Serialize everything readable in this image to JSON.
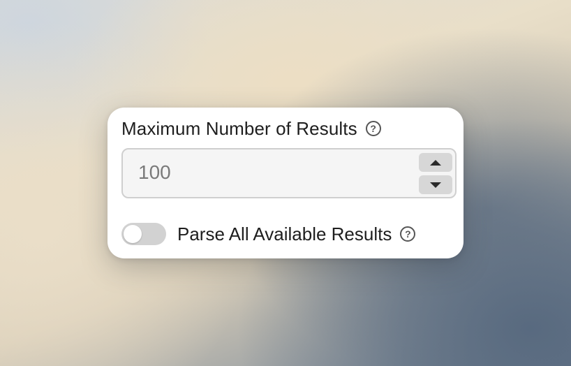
{
  "form": {
    "max_results": {
      "label": "Maximum Number of Results",
      "help_icon": "question-circle-icon",
      "value": "100",
      "increment_icon": "chevron-up-icon",
      "decrement_icon": "chevron-down-icon"
    },
    "parse_all": {
      "label": "Parse All Available Results",
      "help_icon": "question-circle-icon",
      "enabled": false
    }
  },
  "colors": {
    "card_background": "#ffffff",
    "input_background": "#f5f5f5",
    "input_border": "#cfcfcf",
    "stepper_button": "#d7d7d7",
    "toggle_off": "#d2d2d2",
    "text": "#1e1e1e",
    "value_text": "#7a7a7a"
  }
}
